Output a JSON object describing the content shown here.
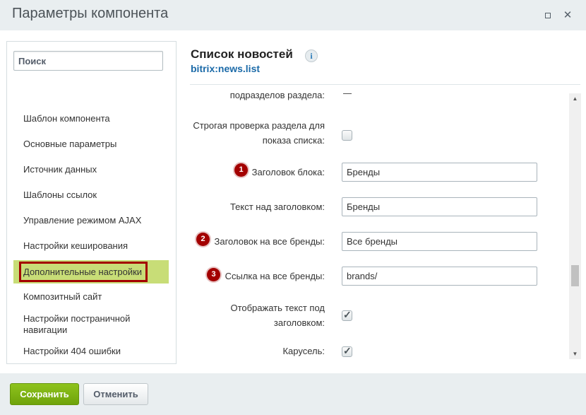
{
  "window": {
    "title": "Параметры компонента",
    "max_icon": "maximize-icon",
    "close_icon": "close-icon",
    "close_glyph": "✕"
  },
  "sidebar": {
    "search_placeholder": "Поиск",
    "items": [
      {
        "label": "Шаблон компонента",
        "active": false
      },
      {
        "label": "Основные параметры",
        "active": false
      },
      {
        "label": "Источник данных",
        "active": false
      },
      {
        "label": "Шаблоны ссылок",
        "active": false
      },
      {
        "label": "Управление режимом AJAX",
        "active": false
      },
      {
        "label": "Настройки кеширования",
        "active": false
      },
      {
        "label": "Дополнительные настройки",
        "active": true
      },
      {
        "label": "Композитный сайт",
        "active": false
      },
      {
        "label": "Настройки постраничной навигации",
        "active": false
      },
      {
        "label": "Настройки 404 ошибки",
        "active": false
      }
    ]
  },
  "header": {
    "title": "Список новостей",
    "info_glyph": "i",
    "component_id": "bitrix:news.list"
  },
  "properties": {
    "partial_label": "подразделов раздела:",
    "strict_check": {
      "label": "Строгая проверка раздела для показа списка:",
      "checked": false
    },
    "block_title": {
      "badge": "1",
      "label": "Заголовок блока:",
      "value": "Бренды"
    },
    "text_above": {
      "label": "Текст над заголовком:",
      "value": "Бренды"
    },
    "all_brands_title": {
      "badge": "2",
      "label": "Заголовок на все бренды:",
      "value": "Все бренды"
    },
    "all_brands_link": {
      "badge": "3",
      "label": "Ссылка на все бренды:",
      "value": "brands/"
    },
    "show_text": {
      "label": "Отображать текст под заголовком:",
      "checked": true
    },
    "carousel": {
      "label": "Карусель:",
      "checked": true
    }
  },
  "scrollbar": {
    "up": "▲",
    "down": "▼"
  },
  "footer": {
    "save_label": "Сохранить",
    "cancel_label": "Отменить"
  },
  "colors": {
    "active_item_bg": "#c8dd77",
    "highlight_border": "#a30000",
    "badge": "#a30000",
    "save_button": "#7ab315",
    "link": "#1b6aa8"
  }
}
